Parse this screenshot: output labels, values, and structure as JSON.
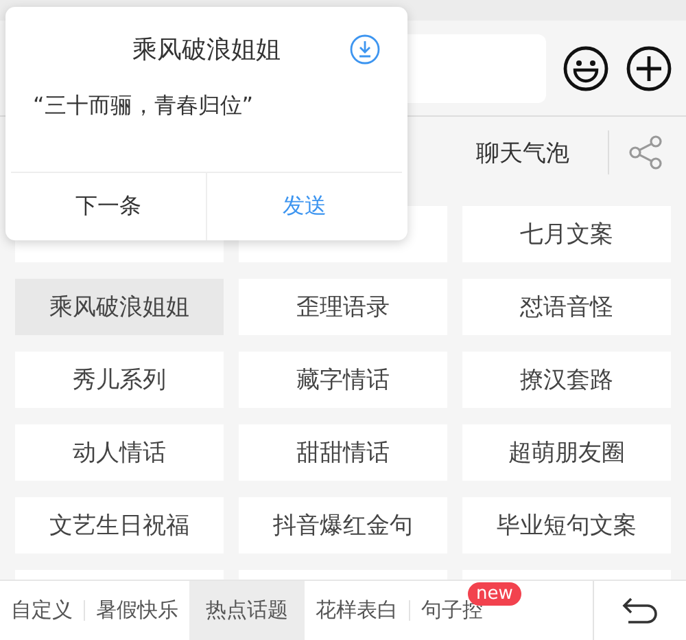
{
  "popup": {
    "title": "乘风破浪姐姐",
    "quote": "“三十而骊，青春归位”",
    "buttons": [
      {
        "label": "下一条",
        "kind": "plain"
      },
      {
        "label": "发送",
        "kind": "primary"
      }
    ]
  },
  "tab_row": {
    "tabs": [
      "聊天气泡"
    ]
  },
  "grid": {
    "cells": [
      {
        "selected": false
      },
      {
        "selected": false
      },
      {
        "label": "七月文案",
        "selected": false
      },
      {
        "label": "乘风破浪姐姐",
        "selected": true
      },
      {
        "label": "歪理语录",
        "selected": false
      },
      {
        "label": "怼语音怪",
        "selected": false
      },
      {
        "label": "秀儿系列",
        "selected": false
      },
      {
        "label": "藏字情话",
        "selected": false
      },
      {
        "label": "撩汉套路",
        "selected": false
      },
      {
        "label": "动人情话",
        "selected": false
      },
      {
        "label": "甜甜情话",
        "selected": false
      },
      {
        "label": "超萌朋友圈",
        "selected": false
      },
      {
        "label": "文艺生日祝福",
        "selected": false
      },
      {
        "label": "抖音爆红金句",
        "selected": false
      },
      {
        "label": "毕业短句文案",
        "selected": false
      },
      {
        "selected": false
      },
      {
        "selected": false
      },
      {
        "selected": false
      }
    ]
  },
  "categories": [
    {
      "label": "自定义",
      "selected": false
    },
    {
      "label": "暑假快乐",
      "selected": false
    },
    {
      "label": "热点话题",
      "selected": true
    },
    {
      "label": "花样表白",
      "selected": false
    },
    {
      "label": "句子控",
      "selected": false,
      "badge": "new"
    }
  ]
}
